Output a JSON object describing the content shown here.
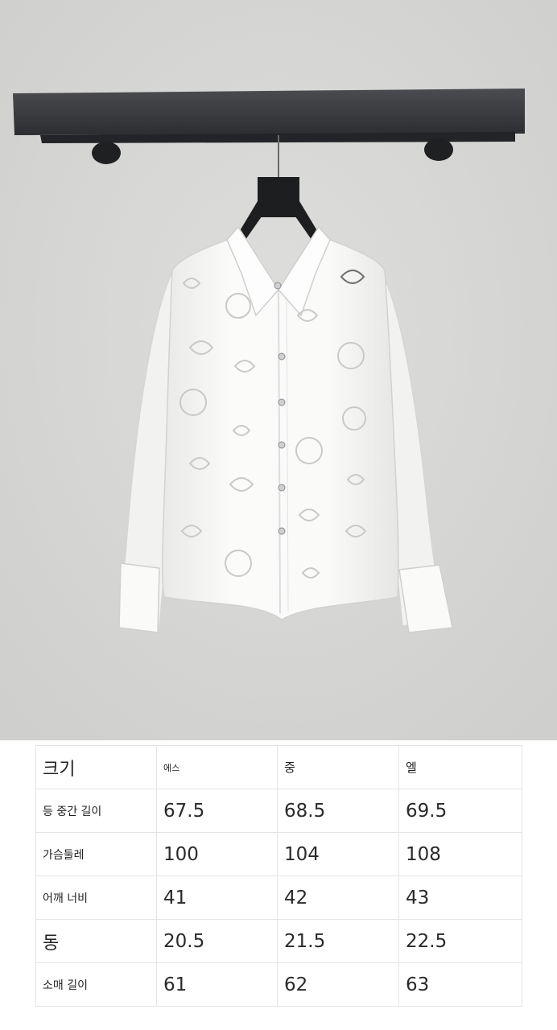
{
  "size_table": {
    "header": [
      "크기",
      "에스",
      "중",
      "엘"
    ],
    "rows": [
      {
        "label": "등 중간 길이",
        "values": [
          "67.5",
          "68.5",
          "69.5"
        ]
      },
      {
        "label": "가슴둘레",
        "values": [
          "100",
          "104",
          "108"
        ]
      },
      {
        "label": "어깨 너비",
        "values": [
          "41",
          "42",
          "43"
        ]
      },
      {
        "label": "동",
        "values": [
          "20.5",
          "21.5",
          "22.5"
        ]
      },
      {
        "label": "소매 길이",
        "values": [
          "61",
          "62",
          "63"
        ]
      }
    ]
  },
  "colors": {
    "wall": "#d9d9d7",
    "shelf": "#3b3d40",
    "shirt": "#f7f7f5"
  }
}
